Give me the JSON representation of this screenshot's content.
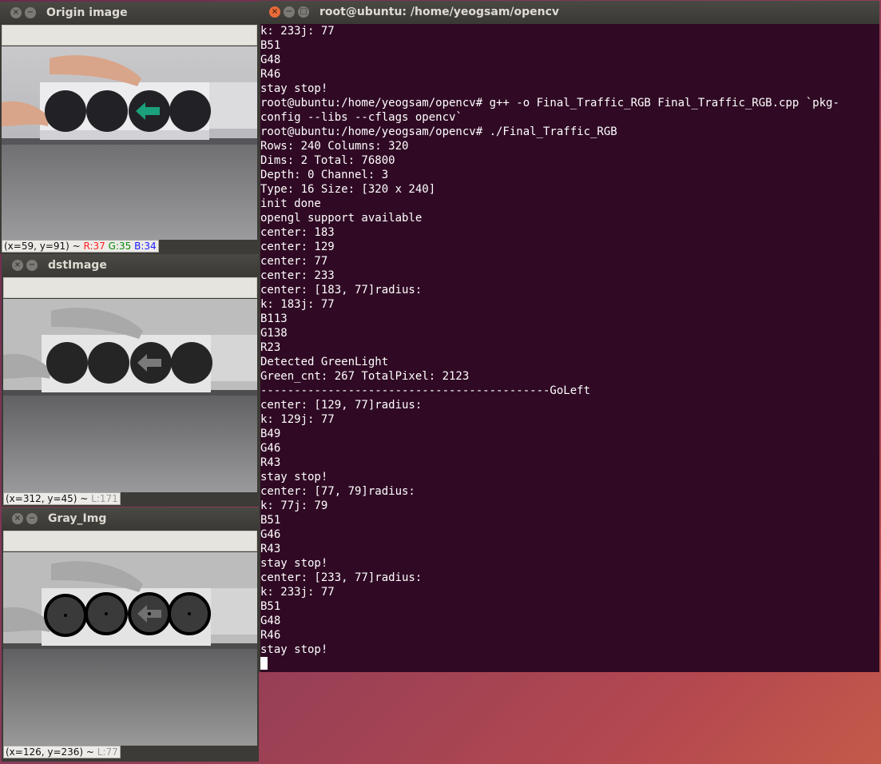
{
  "windows": {
    "origin": {
      "title": "Origin image",
      "status": {
        "coords": "(x=59, y=91) ~ ",
        "r": "R:37",
        "g": "G:35",
        "b": "B:34"
      }
    },
    "dst": {
      "title": "dstImage",
      "status": {
        "coords": "(x=312, y=45) ~ ",
        "l": "L:171"
      }
    },
    "gray": {
      "title": "Gray_Img",
      "status": {
        "coords": "(x=126, y=236) ~ ",
        "l": "L:77"
      }
    },
    "terminal": {
      "title": "root@ubuntu: /home/yeogsam/opencv",
      "lines": [
        "k: 233j: 77",
        "B51",
        "G48",
        "R46",
        "stay stop!",
        "root@ubuntu:/home/yeogsam/opencv# g++ -o Final_Traffic_RGB Final_Traffic_RGB.cpp `pkg-",
        "config --libs --cflags opencv`",
        "root@ubuntu:/home/yeogsam/opencv# ./Final_Traffic_RGB",
        "Rows: 240 Columns: 320",
        "Dims: 2 Total: 76800",
        "Depth: 0 Channel: 3",
        "Type: 16 Size: [320 x 240]",
        "init done",
        "opengl support available",
        "center: 183",
        "center: 129",
        "center: 77",
        "center: 233",
        "center: [183, 77]radius:",
        "k: 183j: 77",
        "B113",
        "G138",
        "R23",
        "Detected GreenLight",
        "Green_cnt: 267 TotalPixel: 2123",
        "-------------------------------------------GoLeft",
        "center: [129, 77]radius:",
        "k: 129j: 77",
        "B49",
        "G46",
        "R43",
        "stay stop!",
        "center: [77, 79]radius:",
        "k: 77j: 79",
        "B51",
        "G46",
        "R43",
        "stay stop!",
        "center: [233, 77]radius:",
        "k: 233j: 77",
        "B51",
        "G48",
        "R46",
        "stay stop!"
      ]
    }
  },
  "colors": {
    "terminal_bg": "#300a24",
    "titlebar": "#3c3b37",
    "close_active": "#e86c3a",
    "green_arrow": "#1aa07a"
  },
  "icons": [
    "close-icon",
    "minimize-icon",
    "maximize-icon"
  ]
}
